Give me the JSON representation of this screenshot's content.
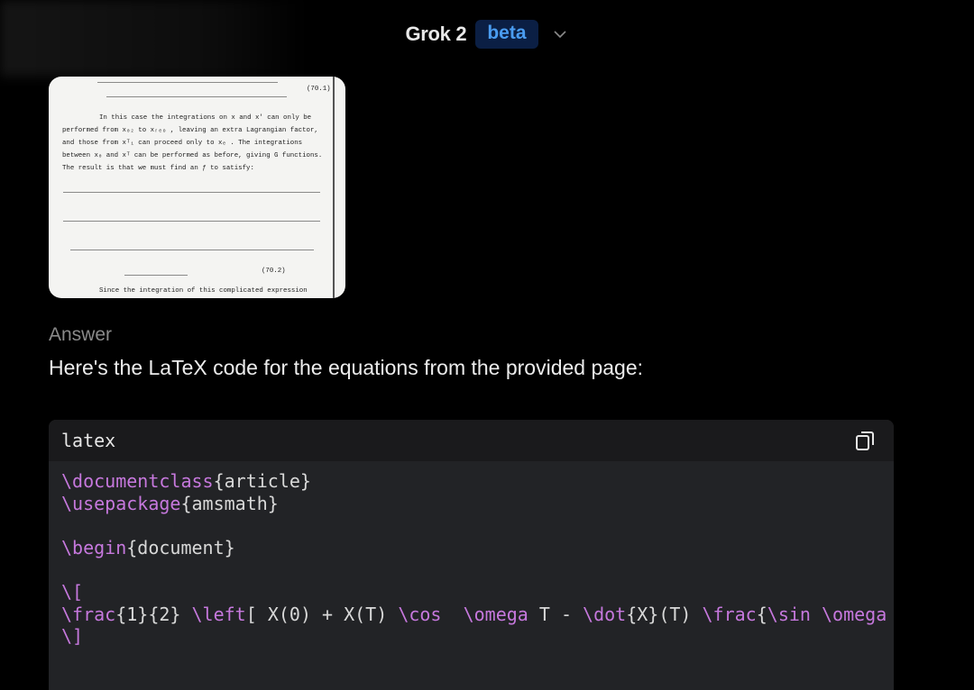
{
  "header": {
    "model": "Grok 2",
    "badge": "beta"
  },
  "attachment": {
    "lines": [
      "In this case the integrations on x and x' can only be",
      "performed from x₀₂ to xᵣₑₒ , leaving an extra Lagrangian factor,",
      "and those from xᵀ₁ can proceed only to xₑ .  The integrations",
      "between x₀ and xᵀ can be performed as before, giving G functions.",
      "The result is that we must find an ƒ to satisfy:",
      "Since the integration of this complicated expression"
    ],
    "eq_labels": [
      "(70.1)",
      "(70.2)"
    ]
  },
  "answer": {
    "label": "Answer",
    "text": "Here's the LaTeX code for the equations from the provided page:"
  },
  "code": {
    "language": "latex",
    "lines": [
      [
        [
          "kw",
          "\\documentclass"
        ],
        [
          "",
          "{article}"
        ]
      ],
      [
        [
          "kw",
          "\\usepackage"
        ],
        [
          "",
          "{amsmath}"
        ]
      ],
      [],
      [
        [
          "kw",
          "\\begin"
        ],
        [
          "",
          "{document}"
        ]
      ],
      [],
      [
        [
          "kw",
          "\\["
        ]
      ],
      [
        [
          "kw",
          "\\frac"
        ],
        [
          "",
          "{1}{2} "
        ],
        [
          "kw",
          "\\left"
        ],
        [
          "",
          "[ X(0) + X(T) "
        ],
        [
          "kw",
          "\\cos"
        ],
        [
          "",
          "  "
        ],
        [
          "kw",
          "\\omega"
        ],
        [
          "",
          " T - "
        ],
        [
          "kw",
          "\\dot"
        ],
        [
          "",
          "{X}(T) "
        ],
        [
          "kw",
          "\\frac"
        ],
        [
          "",
          "{"
        ],
        [
          "kw",
          "\\sin"
        ],
        [
          "",
          " "
        ],
        [
          "kw",
          "\\omega T}{\\omega} \\right]"
        ]
      ],
      [
        [
          "kw",
          "\\]"
        ]
      ]
    ]
  }
}
